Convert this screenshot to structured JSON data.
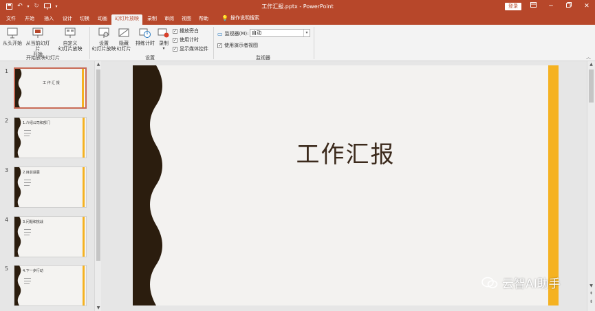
{
  "app": {
    "doc_title": "工作汇报.pptx  -  PowerPoint",
    "login_label": "登录"
  },
  "tabs": [
    "文件",
    "开始",
    "插入",
    "设计",
    "切换",
    "动画",
    "幻灯片放映",
    "录制",
    "审阅",
    "视图",
    "帮助"
  ],
  "active_tab": "幻灯片放映",
  "tell_me": "操作说明搜索",
  "ribbon": {
    "start_group": {
      "from_beginning": "从头开始",
      "from_current_1": "从当前幻灯片",
      "from_current_2": "开始",
      "custom_1": "自定义",
      "custom_2": "幻灯片放映",
      "label": "开始放映幻灯片"
    },
    "setup_group": {
      "setup_1": "设置",
      "setup_2": "幻灯片放映",
      "hide_1": "隐藏",
      "hide_2": "幻灯片",
      "rehearse": "排练计时",
      "record": "录制",
      "play_narrations": "播放旁白",
      "use_timings": "使用计时",
      "show_media_controls": "显示媒体控件",
      "label": "设置"
    },
    "monitors_group": {
      "monitor_label": "监视器(M):",
      "monitor_value": "自动",
      "presenter_view": "使用演示者视图",
      "label": "监视器"
    }
  },
  "thumbnails": [
    {
      "num": "1",
      "title": "工 作 汇 报"
    },
    {
      "num": "2",
      "title": "1.介绍公司和部门"
    },
    {
      "num": "3",
      "title": "2.目前进展"
    },
    {
      "num": "4",
      "title": "3.问题和挑战"
    },
    {
      "num": "5",
      "title": "4.下一步行动"
    }
  ],
  "slide": {
    "title": "工作汇报"
  },
  "watermark": "云智AI助手",
  "colors": {
    "accent": "#b7472a",
    "slide_dark": "#2b1d0e",
    "slide_gold": "#f5b221"
  }
}
